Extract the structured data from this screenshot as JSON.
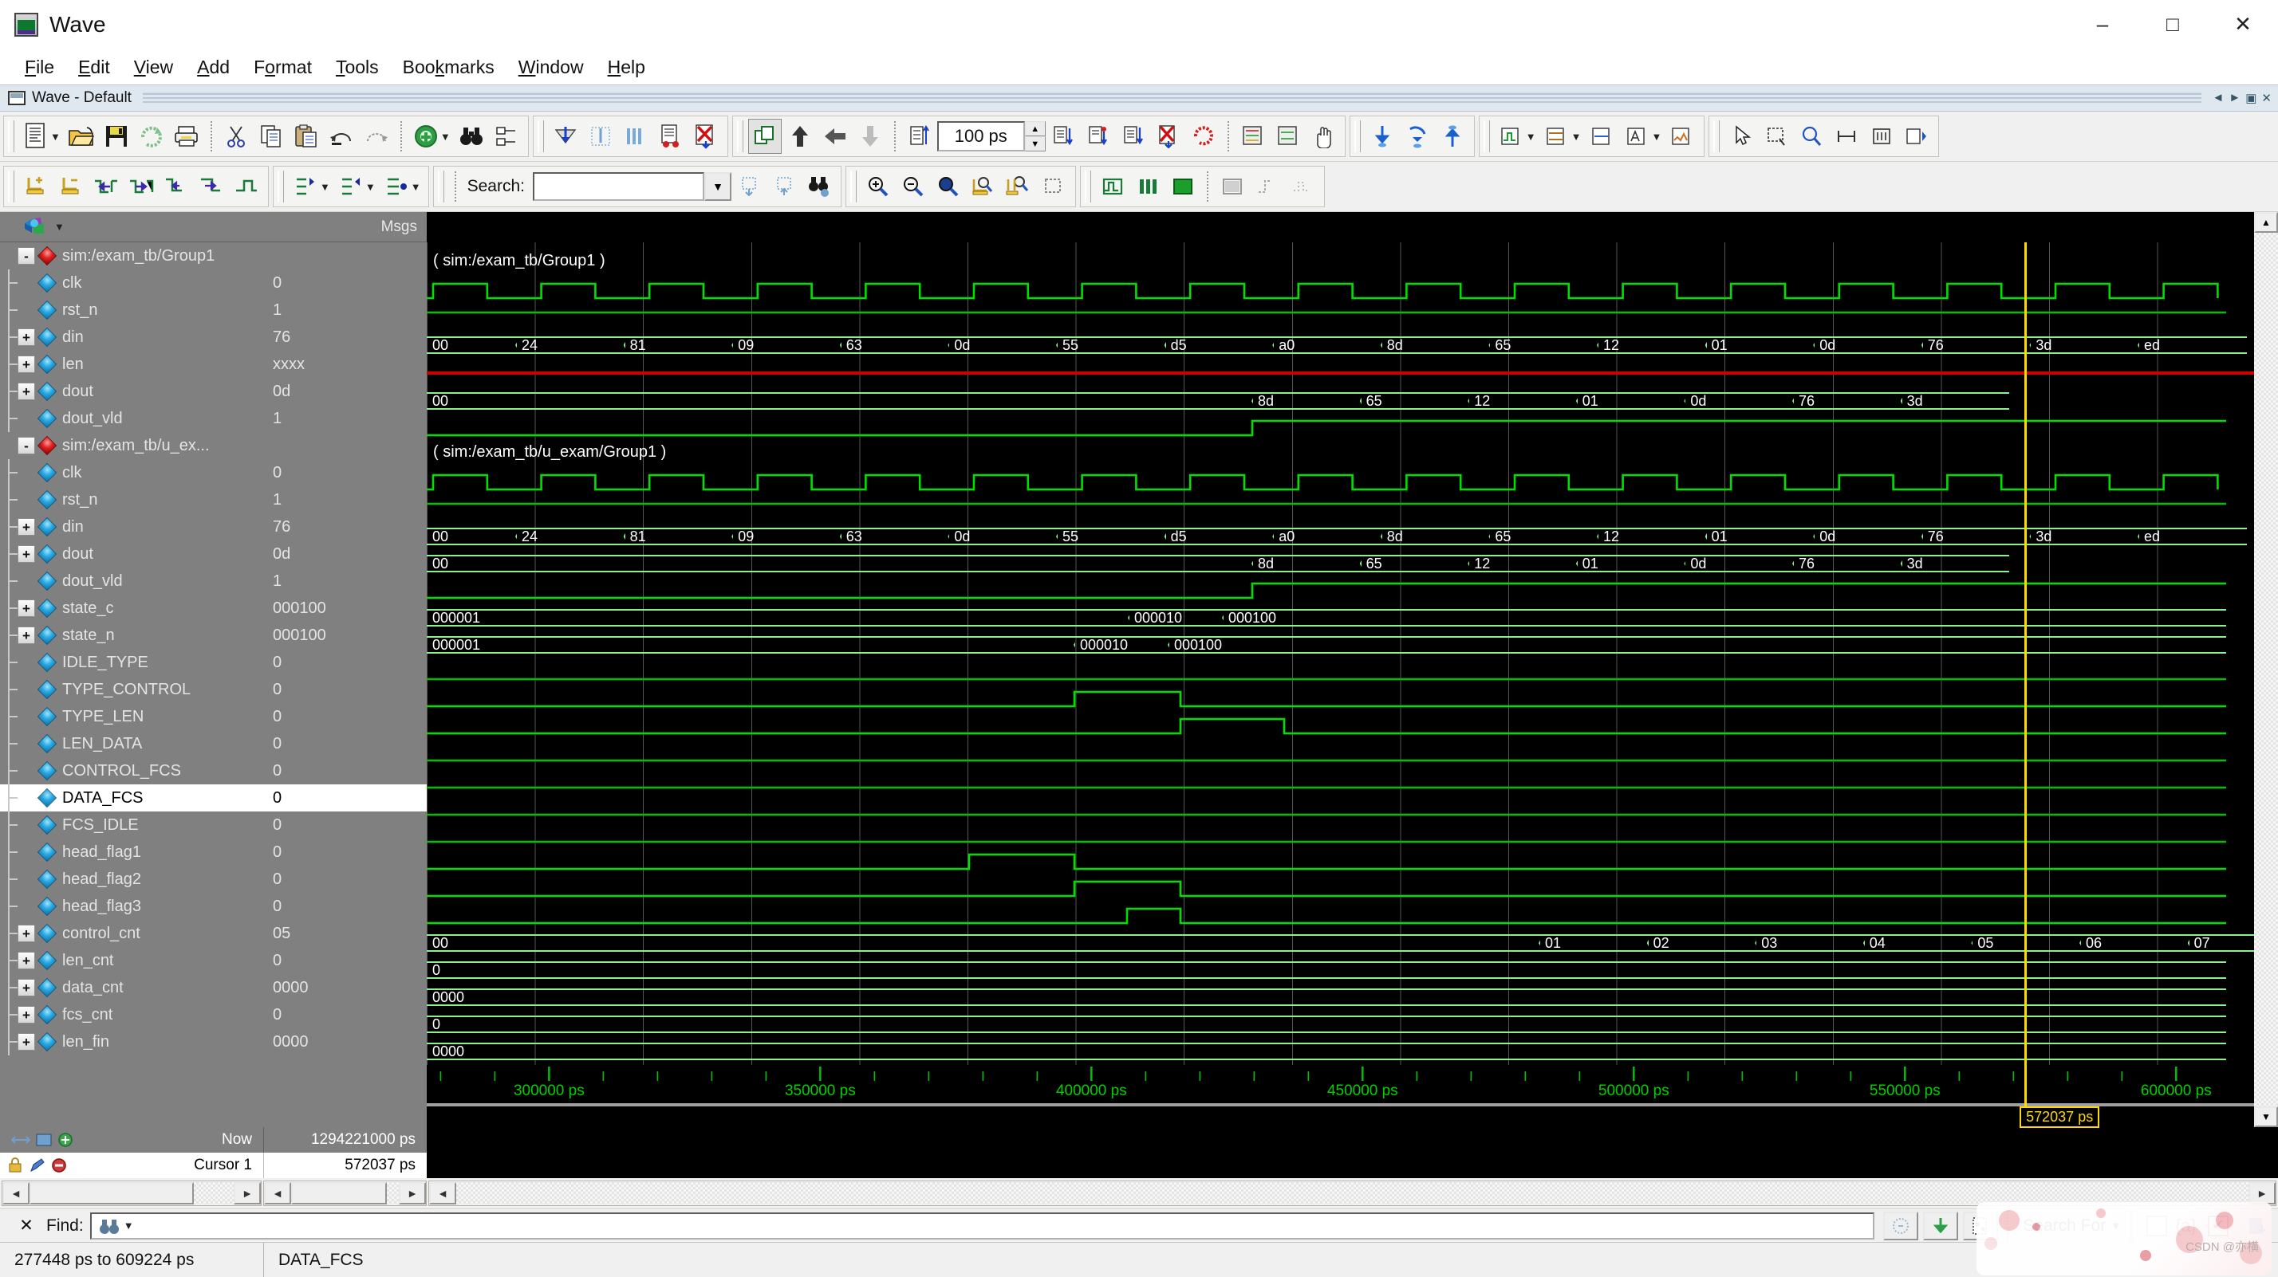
{
  "window": {
    "title": "Wave",
    "icon": "wave-window-icon",
    "minimize": "–",
    "maximize": "□",
    "close": "✕"
  },
  "menubar": [
    {
      "label": "File",
      "mnemonic": "F"
    },
    {
      "label": "Edit",
      "mnemonic": "E"
    },
    {
      "label": "View",
      "mnemonic": "V"
    },
    {
      "label": "Add",
      "mnemonic": "A"
    },
    {
      "label": "Format",
      "mnemonic": "o"
    },
    {
      "label": "Tools",
      "mnemonic": "T"
    },
    {
      "label": "Bookmarks",
      "mnemonic": "k"
    },
    {
      "label": "Window",
      "mnemonic": "W"
    },
    {
      "label": "Help",
      "mnemonic": "H"
    }
  ],
  "tabstrip": {
    "label": "Wave - Default"
  },
  "toolbar": {
    "search_label": "Search:",
    "search_value": "",
    "time_step": "100 ps",
    "search_for_label": "Search For"
  },
  "panes": {
    "names_header": "",
    "values_header": "Msgs"
  },
  "signals": [
    {
      "name": "sim:/exam_tb/Group1",
      "value": "",
      "depth": 0,
      "icon": "group-diamond-red",
      "expander": "-",
      "selected": false
    },
    {
      "name": "clk",
      "value": "0",
      "depth": 1,
      "icon": "signal-diamond",
      "expander": "",
      "selected": false
    },
    {
      "name": "rst_n",
      "value": "1",
      "depth": 1,
      "icon": "signal-diamond",
      "expander": "",
      "selected": false
    },
    {
      "name": "din",
      "value": "76",
      "depth": 1,
      "icon": "signal-diamond",
      "expander": "+",
      "selected": false
    },
    {
      "name": "len",
      "value": "xxxx",
      "depth": 1,
      "icon": "signal-diamond",
      "expander": "+",
      "selected": false
    },
    {
      "name": "dout",
      "value": "0d",
      "depth": 1,
      "icon": "signal-diamond",
      "expander": "+",
      "selected": false
    },
    {
      "name": "dout_vld",
      "value": "1",
      "depth": 1,
      "icon": "signal-diamond",
      "expander": "",
      "selected": false
    },
    {
      "name": "sim:/exam_tb/u_ex...",
      "value": "",
      "depth": 0,
      "icon": "group-diamond-red",
      "expander": "-",
      "selected": false
    },
    {
      "name": "clk",
      "value": "0",
      "depth": 1,
      "icon": "signal-diamond",
      "expander": "",
      "selected": false
    },
    {
      "name": "rst_n",
      "value": "1",
      "depth": 1,
      "icon": "signal-diamond",
      "expander": "",
      "selected": false
    },
    {
      "name": "din",
      "value": "76",
      "depth": 1,
      "icon": "signal-diamond",
      "expander": "+",
      "selected": false
    },
    {
      "name": "dout",
      "value": "0d",
      "depth": 1,
      "icon": "signal-diamond",
      "expander": "+",
      "selected": false
    },
    {
      "name": "dout_vld",
      "value": "1",
      "depth": 1,
      "icon": "signal-diamond",
      "expander": "",
      "selected": false
    },
    {
      "name": "state_c",
      "value": "000100",
      "depth": 1,
      "icon": "signal-diamond",
      "expander": "+",
      "selected": false
    },
    {
      "name": "state_n",
      "value": "000100",
      "depth": 1,
      "icon": "signal-diamond",
      "expander": "+",
      "selected": false
    },
    {
      "name": "IDLE_TYPE",
      "value": "0",
      "depth": 1,
      "icon": "signal-diamond",
      "expander": "",
      "selected": false
    },
    {
      "name": "TYPE_CONTROL",
      "value": "0",
      "depth": 1,
      "icon": "signal-diamond",
      "expander": "",
      "selected": false
    },
    {
      "name": "TYPE_LEN",
      "value": "0",
      "depth": 1,
      "icon": "signal-diamond",
      "expander": "",
      "selected": false
    },
    {
      "name": "LEN_DATA",
      "value": "0",
      "depth": 1,
      "icon": "signal-diamond",
      "expander": "",
      "selected": false
    },
    {
      "name": "CONTROL_FCS",
      "value": "0",
      "depth": 1,
      "icon": "signal-diamond",
      "expander": "",
      "selected": false
    },
    {
      "name": "DATA_FCS",
      "value": "0",
      "depth": 1,
      "icon": "signal-diamond",
      "expander": "",
      "selected": true
    },
    {
      "name": "FCS_IDLE",
      "value": "0",
      "depth": 1,
      "icon": "signal-diamond",
      "expander": "",
      "selected": false
    },
    {
      "name": "head_flag1",
      "value": "0",
      "depth": 1,
      "icon": "signal-diamond",
      "expander": "",
      "selected": false
    },
    {
      "name": "head_flag2",
      "value": "0",
      "depth": 1,
      "icon": "signal-diamond",
      "expander": "",
      "selected": false
    },
    {
      "name": "head_flag3",
      "value": "0",
      "depth": 1,
      "icon": "signal-diamond",
      "expander": "",
      "selected": false
    },
    {
      "name": "control_cnt",
      "value": "05",
      "depth": 1,
      "icon": "signal-diamond",
      "expander": "+",
      "selected": false
    },
    {
      "name": "len_cnt",
      "value": "0",
      "depth": 1,
      "icon": "signal-diamond",
      "expander": "+",
      "selected": false
    },
    {
      "name": "data_cnt",
      "value": "0000",
      "depth": 1,
      "icon": "signal-diamond",
      "expander": "+",
      "selected": false
    },
    {
      "name": "fcs_cnt",
      "value": "0",
      "depth": 1,
      "icon": "signal-diamond",
      "expander": "+",
      "selected": false
    },
    {
      "name": "len_fin",
      "value": "0000",
      "depth": 1,
      "icon": "signal-diamond",
      "expander": "+",
      "selected": false
    }
  ],
  "waveform": {
    "group_labels": [
      {
        "text": "( sim:/exam_tb/Group1 )",
        "row": 0
      },
      {
        "text": "( sim:/exam_tb/u_exam/Group1 )",
        "row": 7
      }
    ],
    "cursor": {
      "label": "572037 ps",
      "time_ps": 572037
    },
    "time_axis": {
      "ticks": [
        {
          "label": "300000 ps",
          "value": 300000
        },
        {
          "label": "350000 ps",
          "value": 350000
        },
        {
          "label": "400000 ps",
          "value": 400000
        },
        {
          "label": "450000 ps",
          "value": 450000
        },
        {
          "label": "500000 ps",
          "value": 500000
        },
        {
          "label": "550000 ps",
          "value": 550000
        },
        {
          "label": "600000 ps",
          "value": 600000
        }
      ],
      "range_start_ps": 277448,
      "range_end_ps": 609224
    },
    "buses": {
      "din_tb": [
        "00",
        "24",
        "81",
        "09",
        "63",
        "0d",
        "55",
        "d5",
        "a0",
        "8d",
        "65",
        "12",
        "01",
        "0d",
        "76",
        "3d",
        "ed"
      ],
      "dout_tb": [
        "00",
        "8d",
        "65",
        "12",
        "01",
        "0d",
        "76",
        "3d"
      ],
      "din_u": [
        "00",
        "24",
        "81",
        "09",
        "63",
        "0d",
        "55",
        "d5",
        "a0",
        "8d",
        "65",
        "12",
        "01",
        "0d",
        "76",
        "3d",
        "ed"
      ],
      "dout_u": [
        "00",
        "8d",
        "65",
        "12",
        "01",
        "0d",
        "76",
        "3d"
      ],
      "state_c": [
        "000001",
        "000010",
        "000100"
      ],
      "state_n": [
        "000001",
        "000010",
        "000100"
      ],
      "control_cnt": [
        "00",
        "01",
        "02",
        "03",
        "04",
        "05",
        "06",
        "07"
      ],
      "len_cnt": [
        "0"
      ],
      "data_cnt": [
        "0000"
      ],
      "fcs_cnt": [
        "0"
      ],
      "len_fin": [
        "0000"
      ]
    }
  },
  "footer": {
    "now_label": "Now",
    "now_value": "1294221000 ps",
    "cursor_label": "Cursor 1",
    "cursor_value": "572037 ps"
  },
  "findbar": {
    "label": "Find:",
    "value": "",
    "close": "✕"
  },
  "statusbar": {
    "range": "277448 ps to 609224 ps",
    "selected_signal": "DATA_FCS"
  },
  "watermark": {
    "text": "CSDN @亦横"
  },
  "colors": {
    "wave_green": "#00d000",
    "bus_green": "#8cf08c",
    "cursor_yellow": "#ffd900",
    "error_red": "#cc0000",
    "pane_gray": "#808080",
    "canvas_black": "#000000"
  }
}
